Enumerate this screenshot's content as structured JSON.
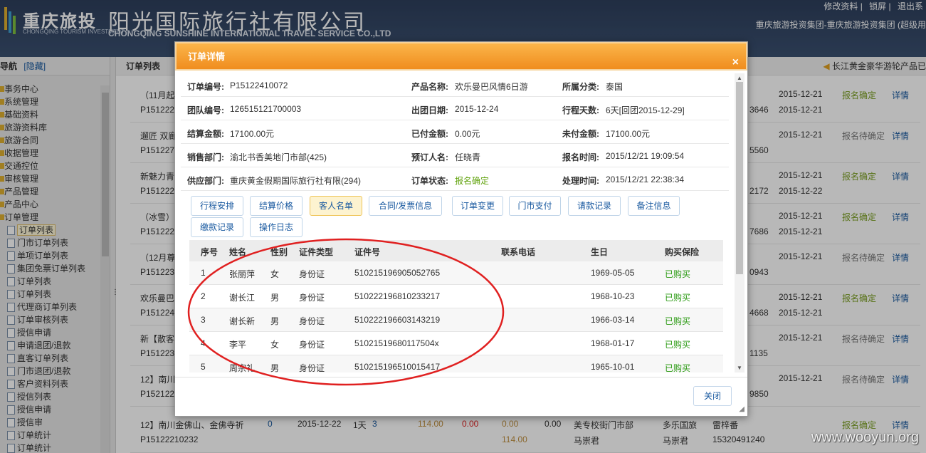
{
  "header": {
    "logo_cn": "重庆旅投",
    "logo_en": "CHONGQING TOURISM INVESTMENT",
    "company_cn": "阳光国际旅行社有限公司",
    "company_en": "CHONGQING SUNSHINE INTERNATIONAL TRAVEL SERVICE CO.,LTD",
    "links": [
      "修改资料",
      "锁屏",
      "退出系"
    ],
    "user_info": "重庆旅游投资集团-重庆旅游投资集团 (超级用"
  },
  "sidebar": {
    "title": "导航",
    "hide_link": "[隐藏]",
    "items": [
      {
        "label": "事务中心",
        "level": 1
      },
      {
        "label": "系统管理",
        "level": 1
      },
      {
        "label": "基础资料",
        "level": 1
      },
      {
        "label": "旅游资料库",
        "level": 1
      },
      {
        "label": "旅游合同",
        "level": 1
      },
      {
        "label": "收据管理",
        "level": 1
      },
      {
        "label": "交通控位",
        "level": 1
      },
      {
        "label": "审核管理",
        "level": 1
      },
      {
        "label": "产品管理",
        "level": 1
      },
      {
        "label": "产品中心",
        "level": 1
      },
      {
        "label": "订单管理",
        "level": 1
      },
      {
        "label": "订单列表",
        "level": 2
      },
      {
        "label": "门市订单列表",
        "level": 2
      },
      {
        "label": "单项订单列表",
        "level": 2
      },
      {
        "label": "集团免票订单列表",
        "level": 2
      },
      {
        "label": "订单列表",
        "level": 2
      },
      {
        "label": "订单列表",
        "level": 2
      },
      {
        "label": "代理商订单列表",
        "level": 2
      },
      {
        "label": "订单审核列表",
        "level": 2
      },
      {
        "label": "授信申请",
        "level": 2
      },
      {
        "label": "申请退团/退款",
        "level": 2
      },
      {
        "label": "直客订单列表",
        "level": 2
      },
      {
        "label": "门市退团/退款",
        "level": 2
      },
      {
        "label": "客户资料列表",
        "level": 2
      },
      {
        "label": "授信列表",
        "level": 2
      },
      {
        "label": "授信申请",
        "level": 2
      },
      {
        "label": "授信审",
        "level": 2
      },
      {
        "label": "订单统计",
        "level": 2
      },
      {
        "label": "订单统计",
        "level": 2
      }
    ]
  },
  "content": {
    "title": "订单列表",
    "notice": "长江黄金豪华游轮产品已",
    "rows": [
      {
        "title": "（11月起",
        "code": "P151222",
        "date1": "2015-12-21",
        "date2": "2015-12-21",
        "status": "报名确定",
        "detail": "详情",
        "phone": "3646"
      },
      {
        "title": "遛匠 双廊",
        "code": "P151227",
        "date1": "2015-12-21",
        "date2": "",
        "status": "报名待确定",
        "detail": "详情",
        "phone": "5560"
      },
      {
        "title": "新魅力青",
        "code": "P151222",
        "date1": "2015-12-21",
        "date2": "2015-12-22",
        "status": "报名确定",
        "detail": "详情",
        "phone": "2172"
      },
      {
        "title": "（冰雪）",
        "code": "P151222",
        "date1": "2015-12-21",
        "date2": "2015-12-21",
        "status": "报名确定",
        "detail": "详情",
        "phone": "7686"
      },
      {
        "title": "（12月尊",
        "code": "P151223",
        "date1": "2015-12-21",
        "date2": "",
        "status": "报名待确定",
        "detail": "详情",
        "phone": "0943"
      },
      {
        "title": "欢乐曼巴",
        "code": "P151224",
        "date1": "2015-12-21",
        "date2": "2015-12-21",
        "status": "报名确定",
        "detail": "详情",
        "phone": "4668"
      },
      {
        "title": "新【散客",
        "code": "P151223",
        "date1": "2015-12-21",
        "date2": "",
        "status": "报名待确定",
        "detail": "详情",
        "phone": "1135"
      },
      {
        "title": "12】南川",
        "code": "P152122",
        "date1": "2015-12-21",
        "date2": "",
        "status": "报名待确定",
        "detail": "详情",
        "phone": "9850"
      }
    ],
    "last_row": {
      "title": "12】南川金佛山、金佛寺祈",
      "code": "P15122210232",
      "count": "0",
      "date": "2015-12-22",
      "days": "1天",
      "num": "3",
      "price1": "114.00",
      "price2": "0.00",
      "price3": "0.00",
      "price4": "0.00",
      "price5": "114.00",
      "dept": "美专校街门市部",
      "person1": "马崇君",
      "agency": "多乐国旅",
      "person2": "雷梓番",
      "person3": "马崇君",
      "phone": "15320491240",
      "status": "报名确定",
      "detail": "详情"
    }
  },
  "dialog": {
    "title": "订单详情",
    "close_icon": "×",
    "info": [
      [
        {
          "label": "订单编号:",
          "value": "P15122410072"
        },
        {
          "label": "产品名称:",
          "value": "欢乐曼巴风情6日游"
        },
        {
          "label": "所属分类:",
          "value": "泰国"
        }
      ],
      [
        {
          "label": "团队编号:",
          "value": "126515121700003"
        },
        {
          "label": "出团日期:",
          "value": "2015-12-24"
        },
        {
          "label": "行程天数:",
          "value": "6天[回团2015-12-29]"
        }
      ],
      [
        {
          "label": "结算金额:",
          "value": "17100.00元"
        },
        {
          "label": "已付金额:",
          "value": "0.00元"
        },
        {
          "label": "未付金额:",
          "value": "17100.00元"
        }
      ],
      [
        {
          "label": "销售部门:",
          "value": "渝北书香美地门市部(425)"
        },
        {
          "label": "预订人名:",
          "value": "任晓青"
        },
        {
          "label": "报名时间:",
          "value": "2015/12/21 19:09:54"
        }
      ],
      [
        {
          "label": "供应部门:",
          "value": "重庆黄金假期国际旅行社有限(294)"
        },
        {
          "label": "订单状态:",
          "value": "报名确定"
        },
        {
          "label": "处理时间:",
          "value": "2015/12/21 22:38:34"
        }
      ]
    ],
    "tabs": [
      "行程安排",
      "结算价格",
      "客人名单",
      "合同/发票信息",
      "订单变更",
      "门市支付",
      "请款记录",
      "备注信息",
      "缴款记录",
      "操作日志"
    ],
    "active_tab": "客人名单",
    "guest_headers": [
      "序号",
      "姓名",
      "性别",
      "证件类型",
      "证件号",
      "联系电话",
      "生日",
      "购买保险"
    ],
    "guests": [
      [
        "1",
        "张丽萍",
        "女",
        "身份证",
        "510215196905052765",
        "",
        "1969-05-05",
        "已购买"
      ],
      [
        "2",
        "谢长江",
        "男",
        "身份证",
        "510222196810233217",
        "",
        "1968-10-23",
        "已购买"
      ],
      [
        "3",
        "谢长新",
        "男",
        "身份证",
        "510222196603143219",
        "",
        "1966-03-14",
        "已购买"
      ],
      [
        "4",
        "李平",
        "女",
        "身份证",
        "51021519680117504x",
        "",
        "1968-01-17",
        "已购买"
      ],
      [
        "5",
        "周宗礼",
        "男",
        "身份证",
        "510215196510015417",
        "",
        "1965-10-01",
        "已购买"
      ]
    ],
    "close_button": "关闭"
  },
  "watermark": "www.wooyun.org",
  "colors": {
    "header_bg": "#2e3f5c",
    "dialog_title": "#f39a2a",
    "confirmed": "#7a9e20",
    "link": "#1a5aa0",
    "annotation": "#e02020"
  }
}
